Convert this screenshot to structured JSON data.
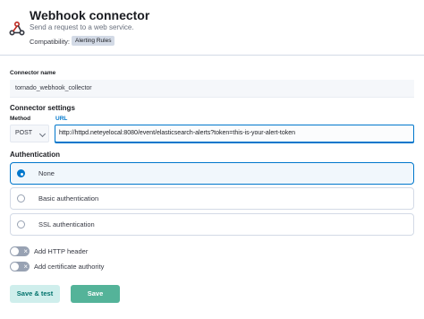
{
  "header": {
    "title": "Webhook connector",
    "subtitle": "Send a request to a web service.",
    "compat_label": "Compatibility:",
    "compat_badge": "Alerting Rules",
    "logo_icon": "webhook-icon"
  },
  "connector_name": {
    "label": "Connector name",
    "value": "tornado_webhook_collector"
  },
  "connector_settings": {
    "title": "Connector settings",
    "method_label": "Method",
    "method_value": "POST",
    "url_label": "URL",
    "url_value": "http://httpd.neteyelocal:8080/event/elasticsearch-alerts?token=this-is-your-alert-token"
  },
  "authentication": {
    "title": "Authentication",
    "options": [
      {
        "label": "None",
        "selected": true
      },
      {
        "label": "Basic authentication",
        "selected": false
      },
      {
        "label": "SSL authentication",
        "selected": false
      }
    ]
  },
  "toggles": [
    {
      "label": "Add HTTP header",
      "on": false
    },
    {
      "label": "Add certificate authority",
      "on": false
    }
  ],
  "actions": {
    "save_test_label": "Save & test",
    "save_label": "Save"
  },
  "colors": {
    "accent": "#0077cc",
    "primary_button": "#54b399",
    "secondary_button": "#cfeeec"
  }
}
